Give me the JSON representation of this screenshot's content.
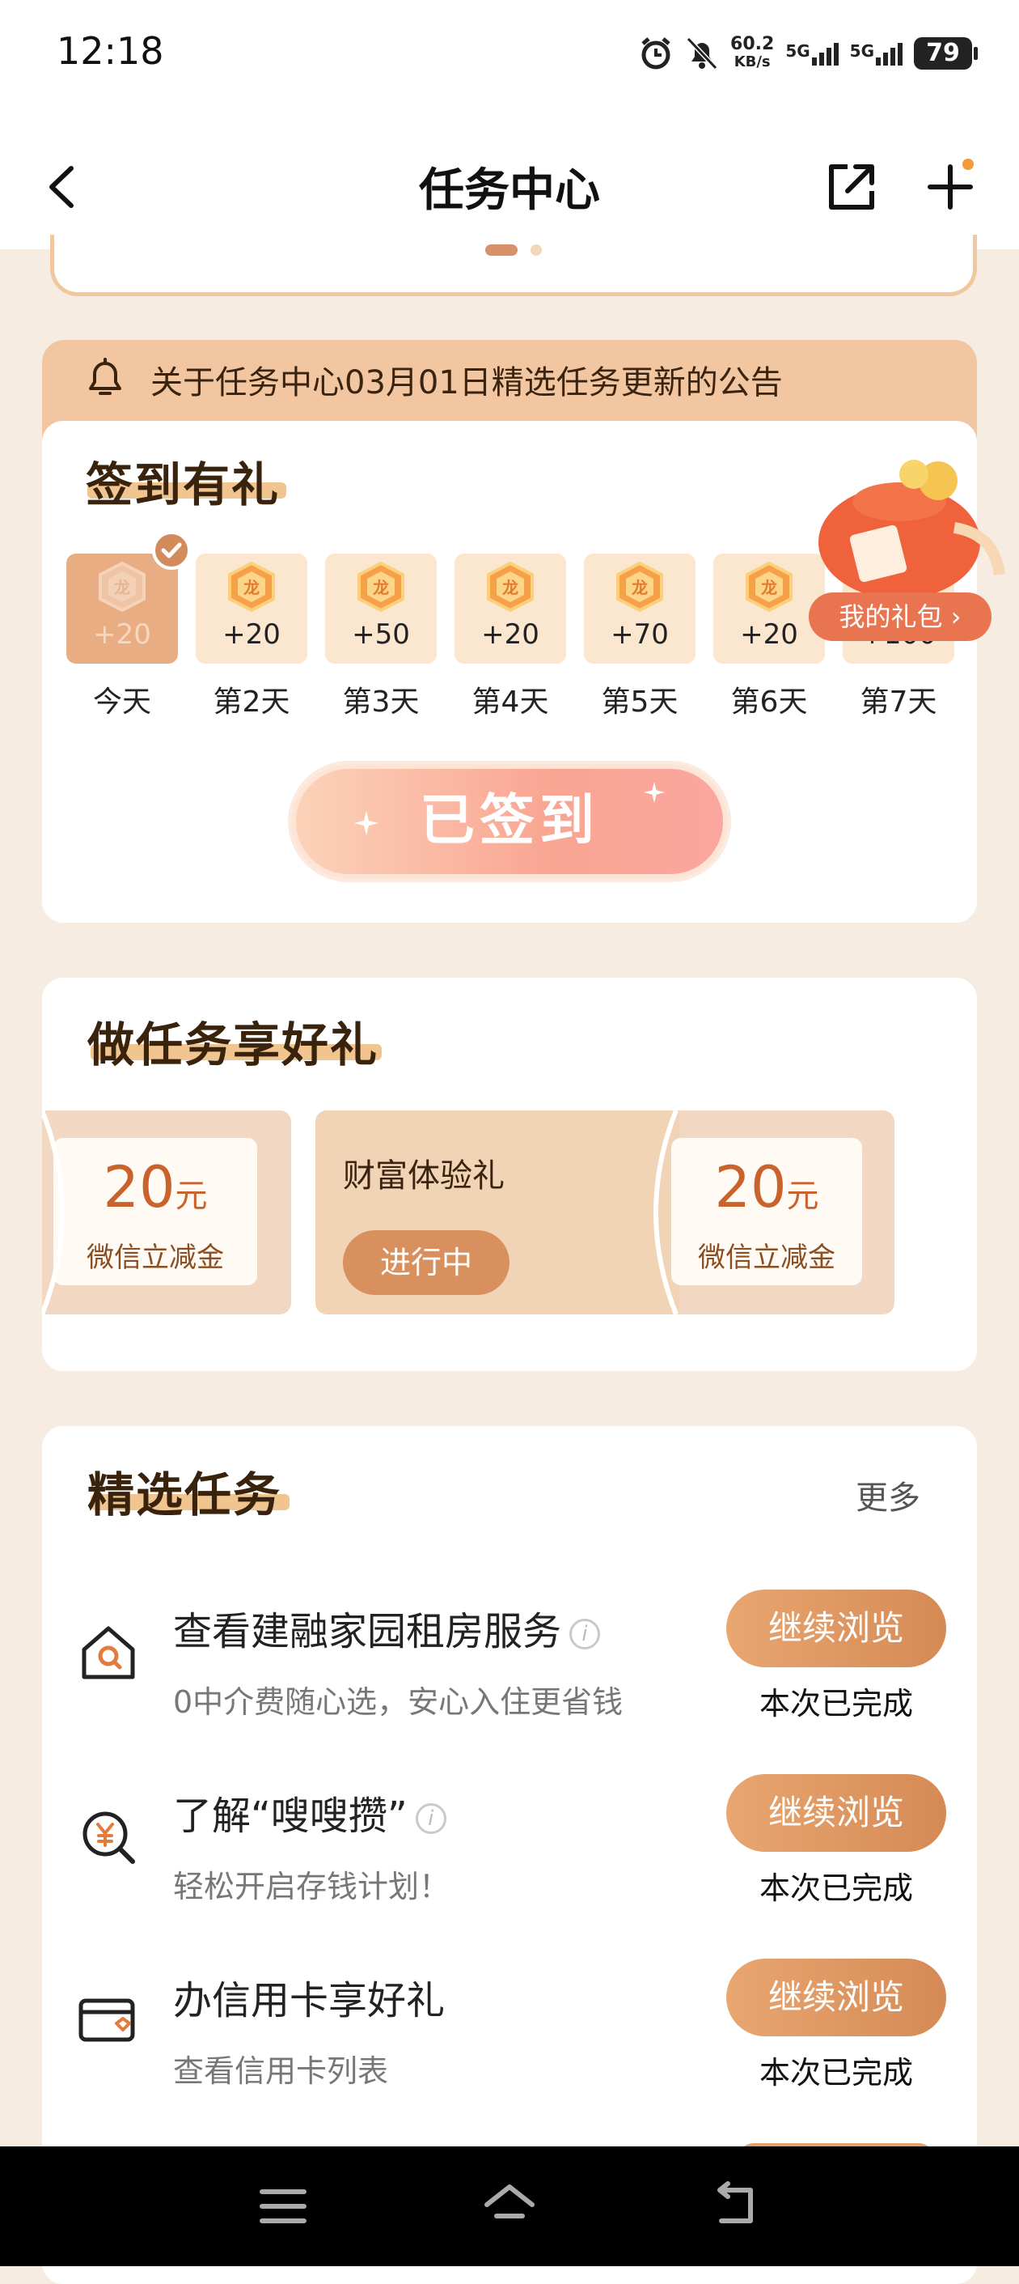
{
  "status_bar": {
    "time": "12:18",
    "net_speed_value": "60.2",
    "net_speed_unit": "KB/s",
    "signal1": "5G",
    "signal2": "5G",
    "battery": "79"
  },
  "header": {
    "title": "任务中心"
  },
  "announcement": {
    "text": "关于任务中心03月01日精选任务更新的公告"
  },
  "signin": {
    "title": "签到有礼",
    "days": [
      {
        "label": "今天",
        "points": "+20"
      },
      {
        "label": "第2天",
        "points": "+20"
      },
      {
        "label": "第3天",
        "points": "+50"
      },
      {
        "label": "第4天",
        "points": "+20"
      },
      {
        "label": "第5天",
        "points": "+70"
      },
      {
        "label": "第6天",
        "points": "+20"
      },
      {
        "label": "第7天",
        "points": "+100"
      }
    ],
    "my_gift": "我的礼包",
    "button": "已签到"
  },
  "tasks": {
    "title": "做任务享好礼",
    "coupon_left": {
      "amount": "20",
      "unit": "元",
      "desc": "微信立减金"
    },
    "reward": {
      "title": "财富体验礼",
      "status": "进行中",
      "amount": "20",
      "unit": "元",
      "desc": "微信立减金"
    }
  },
  "featured": {
    "title": "精选任务",
    "more": "更多",
    "items": [
      {
        "title": "查看建融家园租房服务",
        "desc": "0中介费随心选，安心入住更省钱",
        "button": "继续浏览",
        "status": "本次已完成",
        "icon": "house-search-icon"
      },
      {
        "title": "了解“嗖嗖攒”",
        "desc": "轻松开启存钱计划！",
        "button": "继续浏览",
        "status": "本次已完成",
        "icon": "yuan-search-icon"
      },
      {
        "title": "办信用卡享好礼",
        "desc": "查看信用卡列表",
        "button": "继续浏览",
        "status": "本次已完成",
        "icon": "credit-card-icon"
      }
    ]
  },
  "colors": {
    "accent": "#d68a55",
    "background": "#f6ece1",
    "title_text": "#3a230c"
  }
}
